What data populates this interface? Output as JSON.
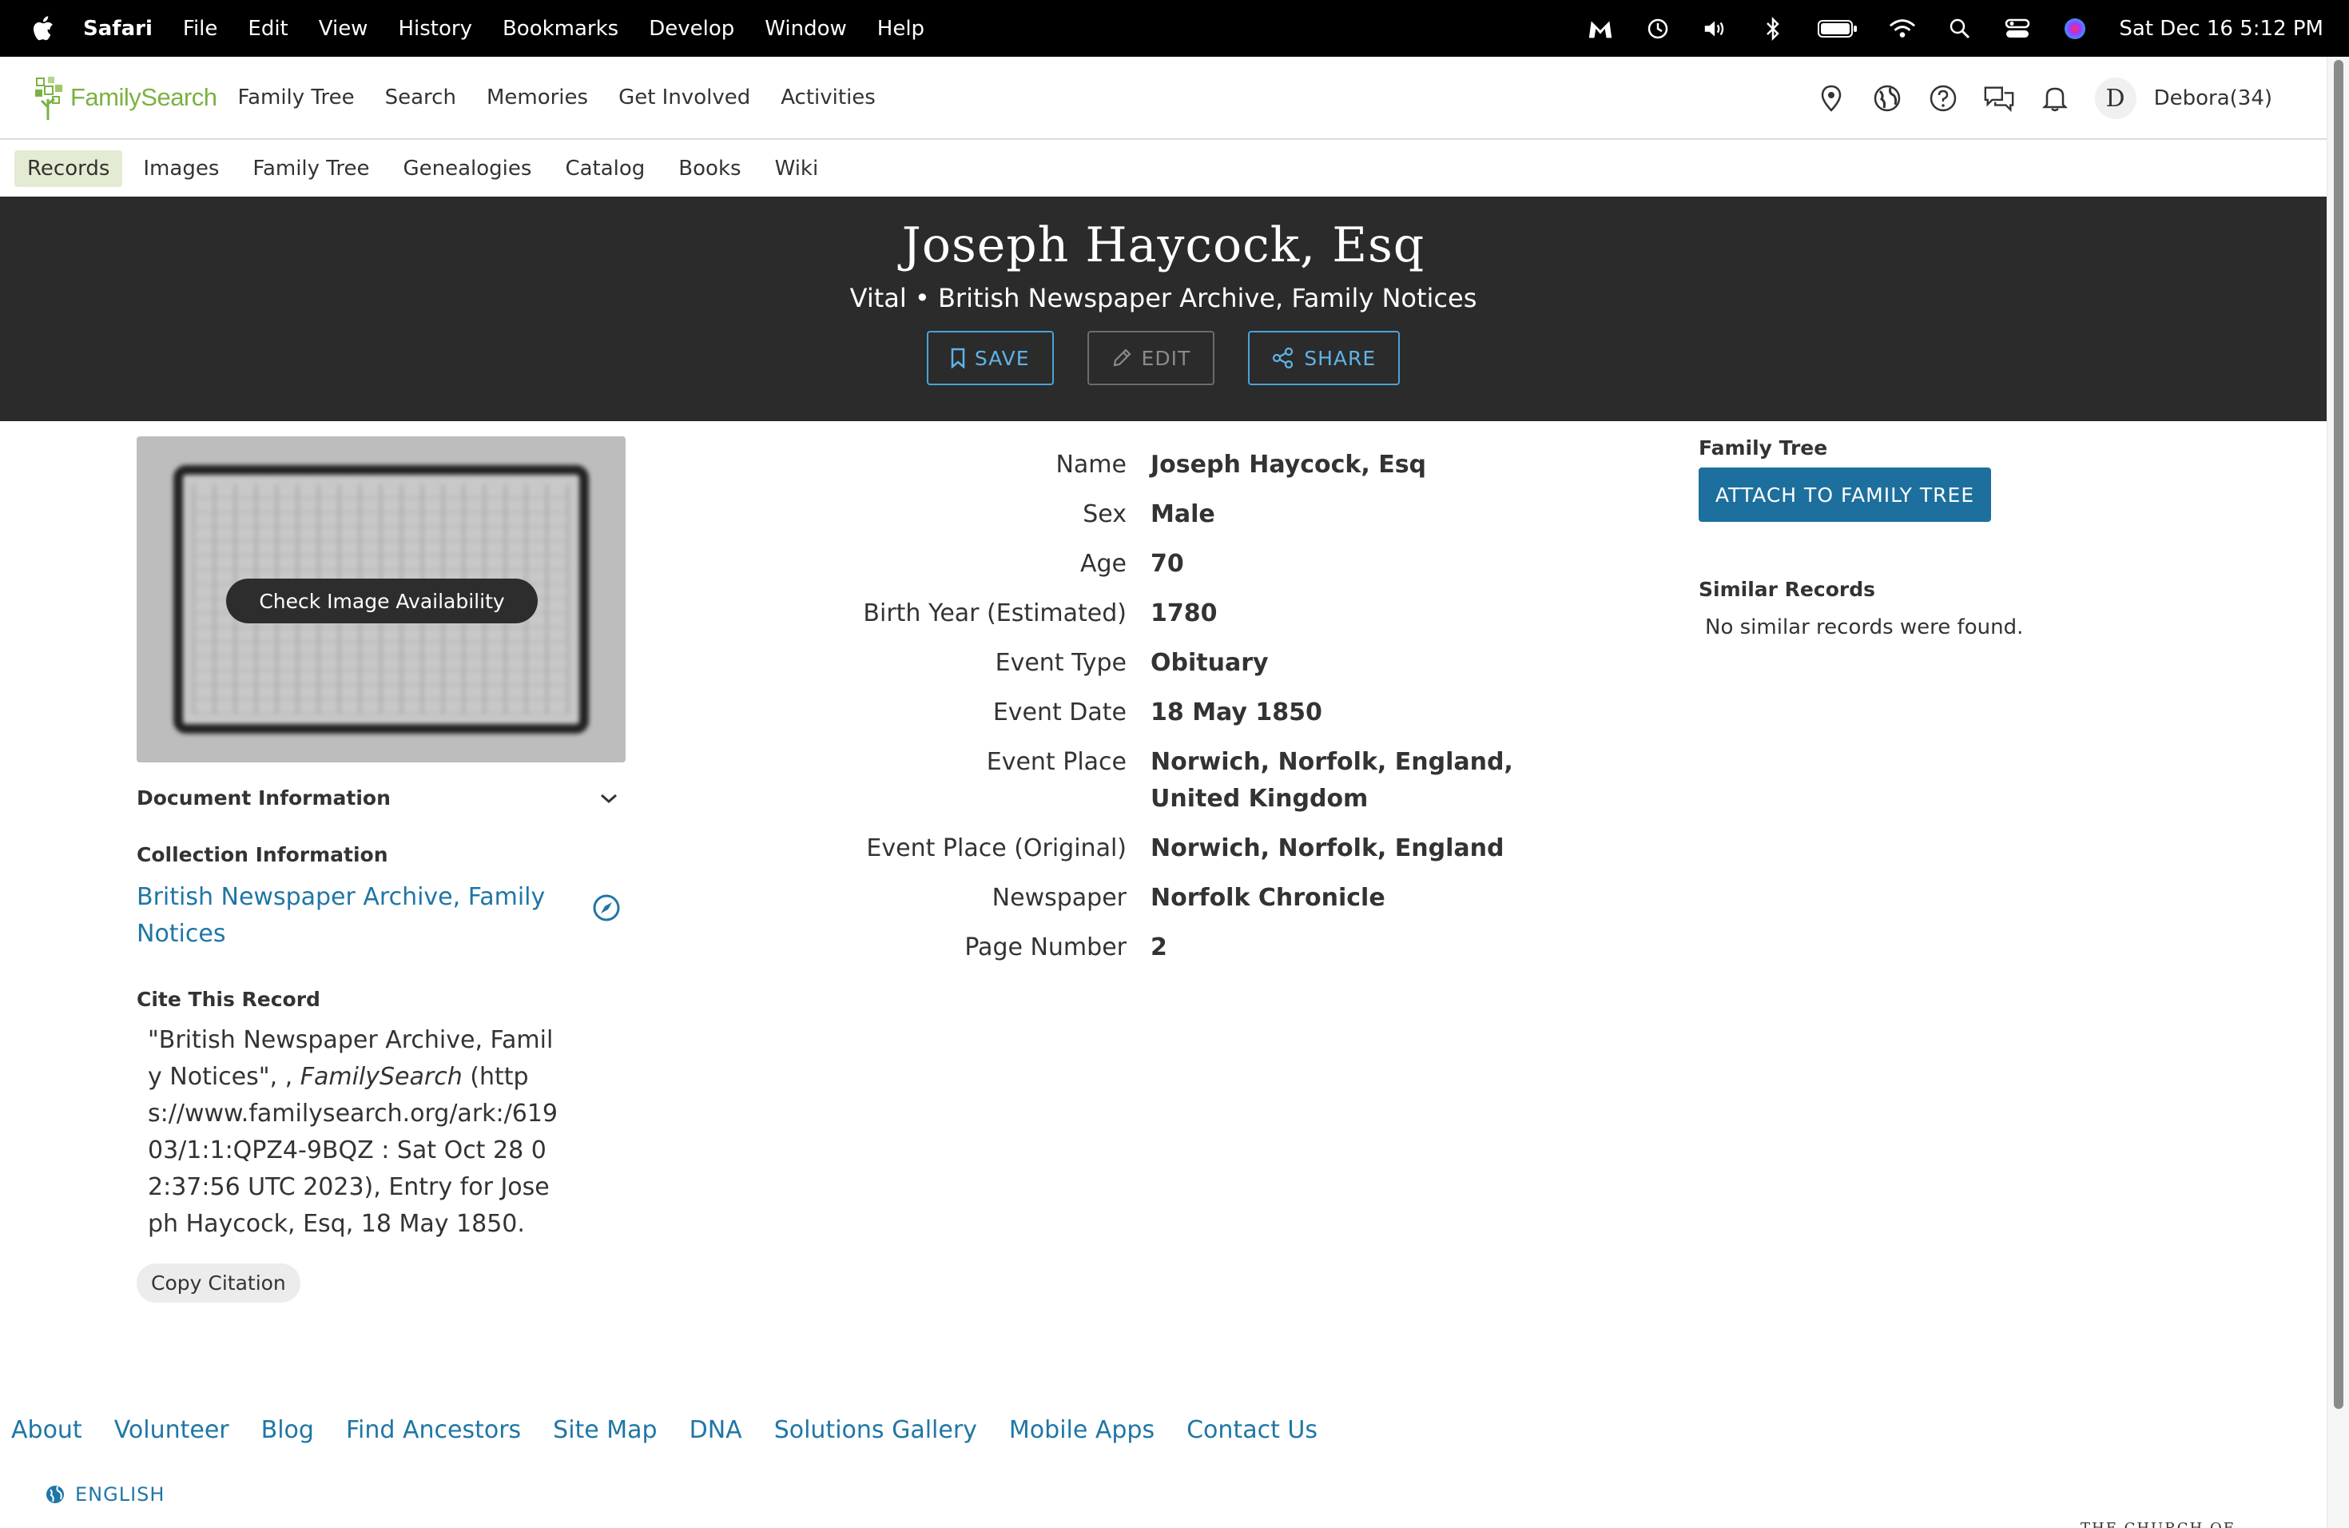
{
  "menubar": {
    "app_name": "Safari",
    "items": [
      "File",
      "Edit",
      "View",
      "History",
      "Bookmarks",
      "Develop",
      "Window",
      "Help"
    ],
    "clock": "Sat Dec 16  5:12 PM"
  },
  "header": {
    "logo_text": "FamilySearch",
    "nav": [
      "Family Tree",
      "Search",
      "Memories",
      "Get Involved",
      "Activities"
    ],
    "avatar_initial": "D",
    "username": "Debora(34)"
  },
  "subnav": [
    "Records",
    "Images",
    "Family Tree",
    "Genealogies",
    "Catalog",
    "Books",
    "Wiki"
  ],
  "banner": {
    "title": "Joseph Haycock, Esq",
    "subtitle": "Vital • British Newspaper Archive, Family Notices",
    "save": "SAVE",
    "edit": "EDIT",
    "share": "SHARE"
  },
  "left": {
    "check_image": "Check Image Availability",
    "document_info": "Document Information",
    "collection_head": "Collection Information",
    "collection_link": "British Newspaper Archive, Family Notices",
    "cite_head": "Cite This Record",
    "cite_part1": "\"British Newspaper Archive, Family Notices\", , ",
    "cite_italic": "FamilySearch",
    "cite_part2": " (https://www.familysearch.org/ark:/61903/1:1:QPZ4-9BQZ : Sat Oct 28 02:37:56 UTC 2023), Entry for Joseph Haycock, Esq, 18 May 1850.",
    "copy_citation": "Copy Citation"
  },
  "details": [
    {
      "label": "Name",
      "value": "Joseph Haycock, Esq"
    },
    {
      "label": "Sex",
      "value": "Male"
    },
    {
      "label": "Age",
      "value": "70"
    },
    {
      "label": "Birth Year (Estimated)",
      "value": "1780"
    },
    {
      "label": "Event Type",
      "value": "Obituary"
    },
    {
      "label": "Event Date",
      "value": "18 May 1850"
    },
    {
      "label": "Event Place",
      "value": "Norwich, Norfolk, England, United Kingdom"
    },
    {
      "label": "Event Place (Original)",
      "value": "Norwich, Norfolk, England"
    },
    {
      "label": "Newspaper",
      "value": "Norfolk Chronicle"
    },
    {
      "label": "Page Number",
      "value": "2"
    }
  ],
  "right": {
    "family_tree_head": "Family Tree",
    "attach": "ATTACH TO FAMILY TREE",
    "similar_head": "Similar Records",
    "similar_text": "No similar records were found."
  },
  "footer": {
    "links": [
      "About",
      "Volunteer",
      "Blog",
      "Find Ancestors",
      "Site Map",
      "DNA",
      "Solutions Gallery",
      "Mobile Apps",
      "Contact Us"
    ],
    "language": "ENGLISH",
    "church_mark": "THE CHURCH OF"
  },
  "colors": {
    "brand_green": "#7ab242",
    "link_blue": "#1f76a6",
    "banner_bg": "#2b2b2b",
    "attach_button": "#1d6f9d",
    "active_tab": "#e3ecd2"
  }
}
